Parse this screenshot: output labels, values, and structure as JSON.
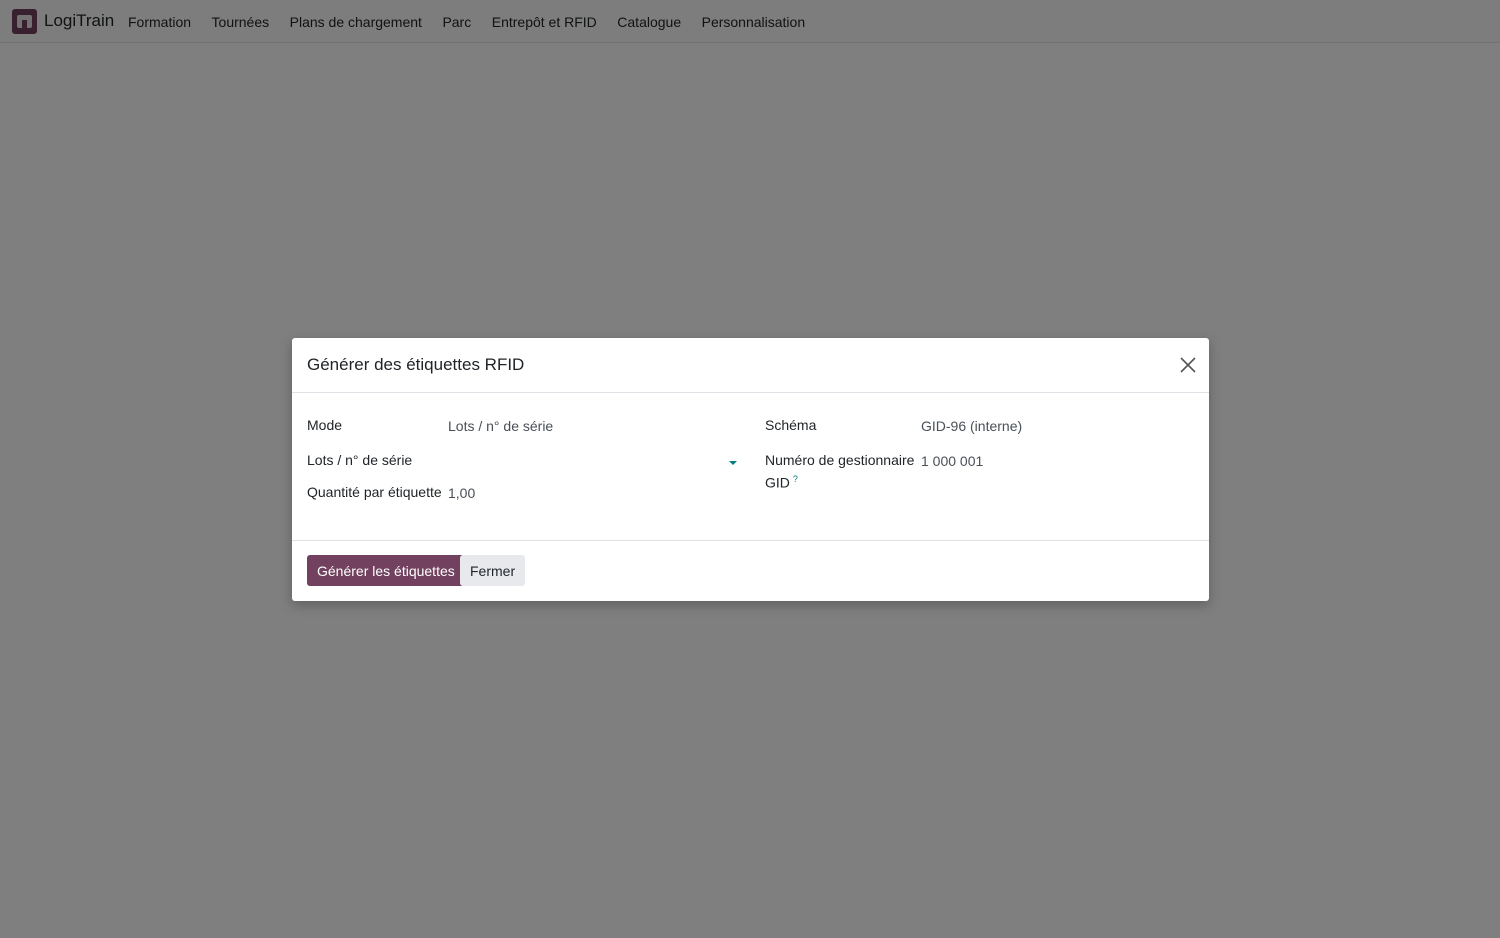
{
  "navbar": {
    "brand": "LogiTrain",
    "menu": [
      "Formation",
      "Tournées",
      "Plans de chargement",
      "Parc",
      "Entrepôt et RFID",
      "Catalogue",
      "Personnalisation"
    ]
  },
  "dialog": {
    "title": "Générer des étiquettes RFID",
    "fields": {
      "mode_label": "Mode",
      "mode_value": "Lots / n° de série",
      "lots_label": "Lots / n° de série",
      "lots_value": "",
      "qty_label": "Quantité par étiquette",
      "qty_value": "1,00",
      "schema_label": "Schéma",
      "schema_value": "GID-96 (interne)",
      "gid_label_line1": "Numéro de gestionnaire",
      "gid_label_line2": "GID",
      "gid_help": "?",
      "gid_value": "1 000 001"
    },
    "buttons": {
      "generate": "Générer les étiquettes",
      "close": "Fermer"
    }
  },
  "colors": {
    "brand": "#71415f",
    "accent": "#017e84",
    "backdrop": "rgba(0,0,0,0.5)"
  },
  "icons": {
    "app": "app-logo-icon",
    "close": "close-icon",
    "dropdown": "caret-down-icon"
  }
}
